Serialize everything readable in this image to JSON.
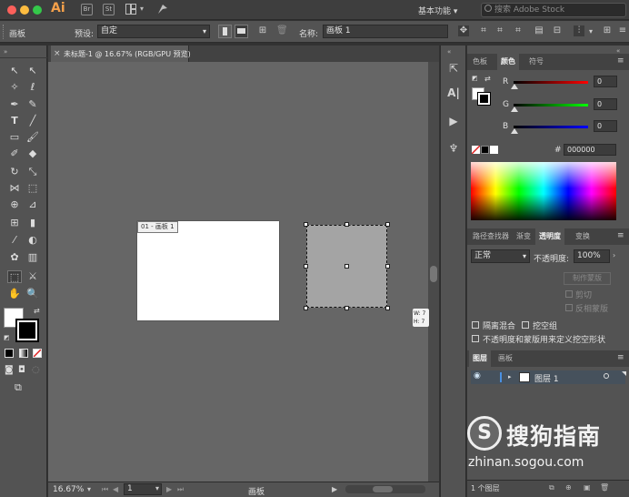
{
  "titlebar": {
    "app_logo": "Ai",
    "icons": [
      {
        "name": "bridge-icon",
        "text": "Br"
      },
      {
        "name": "stock-icon",
        "text": "St"
      }
    ],
    "workspace": "基本功能",
    "stock_search_placeholder": "搜索 Adobe Stock",
    "colors": {
      "close": "#fc605b",
      "minimize": "#fdbc40",
      "maximize": "#34c84a",
      "accent": "#f5a04a"
    }
  },
  "controlbar": {
    "tool_name": "画板",
    "preset_label": "预设:",
    "preset_value": "自定",
    "name_label": "名称:",
    "name_value": "画板 1"
  },
  "document": {
    "tab_close": "×",
    "tab_title": "未标题-1 @ 16.67% (RGB/GPU 预览)",
    "artboard_label": "01 - 画板 1",
    "tooltip_w": "W: 7",
    "tooltip_h": "H: 7"
  },
  "statusbar": {
    "zoom": "16.67%",
    "page": "1",
    "status_text": "画板"
  },
  "color_panel": {
    "tabs": [
      "色板",
      "颜色",
      "符号"
    ],
    "active_tab": "颜色",
    "channels": [
      {
        "label": "R",
        "value": "0"
      },
      {
        "label": "G",
        "value": "0"
      },
      {
        "label": "B",
        "value": "0"
      }
    ],
    "hex_label": "#",
    "hex_value": "000000"
  },
  "transparency_panel": {
    "tabs": [
      "路径查找器",
      "渐变",
      "透明度",
      "变换"
    ],
    "active_tab": "透明度",
    "blend_mode": "正常",
    "opacity_label": "不透明度:",
    "opacity_value": "100%",
    "make_mask": "制作蒙版",
    "clip": "剪切",
    "invert_mask": "反相蒙版",
    "isolate_blending": "隔离混合",
    "knockout_group": "挖空组",
    "opacity_mask_knockout": "不透明度和蒙版用来定义挖空形状"
  },
  "layers_panel": {
    "tabs": [
      "图层",
      "画板"
    ],
    "active_tab": "图层",
    "layer_name": "图层 1",
    "count": "1 个图层"
  },
  "watermark": {
    "logo": "S",
    "text": "搜狗指南",
    "url": "zhinan.sogou.com"
  }
}
